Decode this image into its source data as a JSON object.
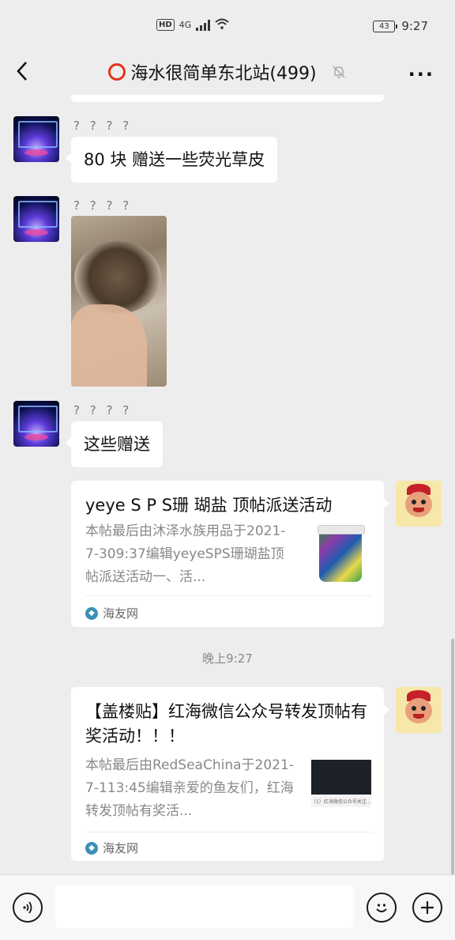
{
  "status": {
    "network": "4G",
    "battery": "43",
    "time": "9:27"
  },
  "nav": {
    "title": "海水很简单东北站(499)"
  },
  "messages": [
    {
      "sender": "? ? ? ?",
      "text": "80 块 赠送一些荧光草皮"
    },
    {
      "sender": "? ? ? ?"
    },
    {
      "sender": "? ? ? ?",
      "text": "这些赠送"
    }
  ],
  "cards": [
    {
      "title": "yeye S P S珊 瑚盐 顶帖派送活动",
      "desc": "本帖最后由沐泽水族用品于2021-7-309:37编辑yeyeSPS珊瑚盐顶帖派送活动一、活...",
      "source": "海友网"
    },
    {
      "title": "【盖楼贴】红海微信公众号转发顶帖有奖活动！！！",
      "desc": "本帖最后由RedSeaChina于2021-7-113:45编辑亲爱的鱼友们，红海转发顶帖有奖活...",
      "source": "海友网",
      "thumb_caption": "（1）红海微信公众号关注..."
    }
  ],
  "timestamp": "晚上9:27",
  "colors": {
    "background": "#ededed",
    "bubble": "#ffffff",
    "accent_ring": "#e0341f"
  }
}
